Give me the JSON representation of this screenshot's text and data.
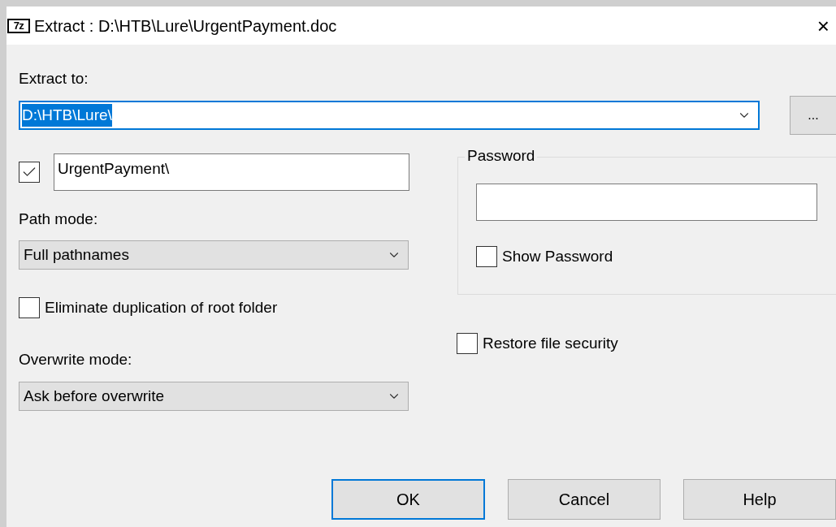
{
  "window": {
    "logo": "7z",
    "title": "Extract : D:\\HTB\\Lure\\UrgentPayment.doc",
    "close": "×"
  },
  "extract_to": {
    "label": "Extract to:",
    "value": "D:\\HTB\\Lure\\",
    "text_selected": true
  },
  "browse_button": "...",
  "subfolder": {
    "checked": true,
    "value": "UrgentPayment\\"
  },
  "path_mode": {
    "label": "Path mode:",
    "value": "Full pathnames"
  },
  "eliminate_duplication": {
    "label": "Eliminate duplication of root folder",
    "checked": false
  },
  "overwrite_mode": {
    "label": "Overwrite mode:",
    "value": "Ask before overwrite"
  },
  "password": {
    "legend": "Password",
    "show_password": {
      "label": "Show Password",
      "checked": false
    }
  },
  "restore_file_security": {
    "label": "Restore file security",
    "checked": false
  },
  "buttons": [
    {
      "label": "OK",
      "default": true
    },
    {
      "label": "Cancel",
      "default": false
    },
    {
      "label": "Help",
      "default": false
    }
  ]
}
